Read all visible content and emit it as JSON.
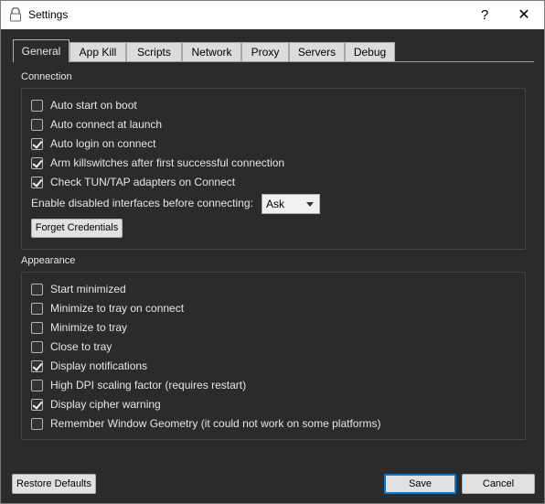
{
  "window": {
    "title": "Settings",
    "help_label": "?",
    "close_label": "✕"
  },
  "tabs": [
    {
      "label": "General",
      "active": true
    },
    {
      "label": "App Kill"
    },
    {
      "label": "Scripts"
    },
    {
      "label": "Network"
    },
    {
      "label": "Proxy"
    },
    {
      "label": "Servers"
    },
    {
      "label": "Debug"
    }
  ],
  "connection": {
    "title": "Connection",
    "options": [
      {
        "label": "Auto start on boot",
        "checked": false
      },
      {
        "label": "Auto connect at launch",
        "checked": false
      },
      {
        "label": "Auto login on connect",
        "checked": true
      },
      {
        "label": "Arm killswitches after first successful connection",
        "checked": true
      },
      {
        "label": "Check TUN/TAP adapters on Connect",
        "checked": true
      }
    ],
    "enable_interfaces_label": "Enable disabled interfaces before connecting:",
    "enable_interfaces_value": "Ask",
    "forget_credentials_label": "Forget Credentials"
  },
  "appearance": {
    "title": "Appearance",
    "options": [
      {
        "label": "Start minimized",
        "checked": false
      },
      {
        "label": "Minimize to tray on connect",
        "checked": false
      },
      {
        "label": "Minimize to tray",
        "checked": false
      },
      {
        "label": "Close to tray",
        "checked": false
      },
      {
        "label": "Display notifications",
        "checked": true
      },
      {
        "label": "High DPI scaling factor (requires restart)",
        "checked": false
      },
      {
        "label": "Display cipher warning",
        "checked": true
      },
      {
        "label": "Remember Window Geometry (it could not work on some platforms)",
        "checked": false
      }
    ]
  },
  "footer": {
    "restore_defaults_label": "Restore Defaults",
    "save_label": "Save",
    "cancel_label": "Cancel"
  }
}
